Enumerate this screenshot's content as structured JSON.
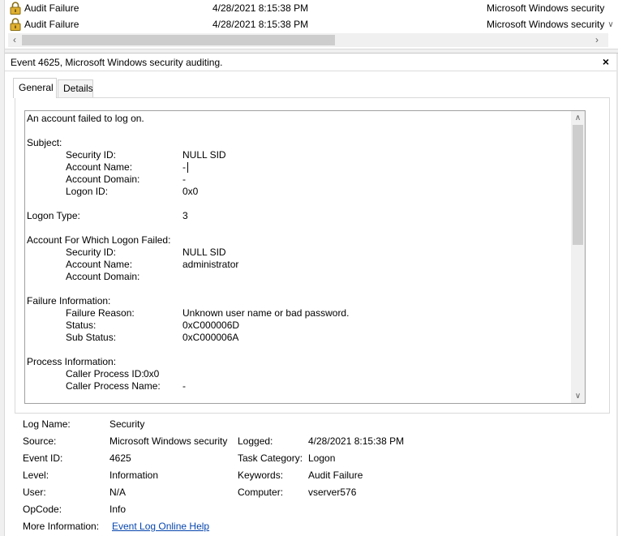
{
  "event_list": {
    "rows": [
      {
        "level": "Audit Failure",
        "date": "4/28/2021 8:15:38 PM",
        "source": "Microsoft Windows security"
      },
      {
        "level": "Audit Failure",
        "date": "4/28/2021 8:15:38 PM",
        "source": "Microsoft Windows security"
      }
    ],
    "hscroll_fraction": 0.55
  },
  "detail": {
    "title": "Event 4625, Microsoft Windows security auditing.",
    "close_label": "×",
    "tabs": [
      {
        "label": "General",
        "active": true
      },
      {
        "label": "Details",
        "active": false
      }
    ],
    "description": {
      "intro": "An account failed to log on.",
      "subject": {
        "heading": "Subject:",
        "fields": [
          {
            "label": "Security ID:",
            "value": "NULL SID"
          },
          {
            "label": "Account Name:",
            "value": "-"
          },
          {
            "label": "Account Domain:",
            "value": "-"
          },
          {
            "label": "Logon ID:",
            "value": "0x0"
          }
        ]
      },
      "logon_type": {
        "label": "Logon Type:",
        "value": "3"
      },
      "account_failed": {
        "heading": "Account For Which Logon Failed:",
        "fields": [
          {
            "label": "Security ID:",
            "value": "NULL SID"
          },
          {
            "label": "Account Name:",
            "value": "administrator"
          },
          {
            "label": "Account Domain:",
            "value": ""
          }
        ]
      },
      "failure_info": {
        "heading": "Failure Information:",
        "fields": [
          {
            "label": "Failure Reason:",
            "value": "Unknown user name or bad password."
          },
          {
            "label": "Status:",
            "value": "0xC000006D"
          },
          {
            "label": "Sub Status:",
            "value": "0xC000006A"
          }
        ]
      },
      "process_info": {
        "heading": "Process Information:",
        "fields": [
          {
            "label": "Caller Process ID:",
            "value": "0x0"
          },
          {
            "label": "Caller Process Name:",
            "value": "-"
          }
        ]
      }
    },
    "properties": {
      "log_name": {
        "label": "Log Name:",
        "value": "Security"
      },
      "source": {
        "label": "Source:",
        "value": "Microsoft Windows security"
      },
      "logged": {
        "label": "Logged:",
        "value": "4/28/2021 8:15:38 PM"
      },
      "event_id": {
        "label": "Event ID:",
        "value": "4625"
      },
      "task_category": {
        "label": "Task Category:",
        "value": "Logon"
      },
      "level": {
        "label": "Level:",
        "value": "Information"
      },
      "keywords": {
        "label": "Keywords:",
        "value": "Audit Failure"
      },
      "user": {
        "label": "User:",
        "value": "N/A"
      },
      "computer": {
        "label": "Computer:",
        "value": "vserver576"
      },
      "opcode": {
        "label": "OpCode:",
        "value": "Info"
      },
      "more_info": {
        "label": "More Information:",
        "link": "Event Log Online Help"
      }
    }
  },
  "colors": {
    "link": "#0645ad",
    "lock_gold": "#d9a520"
  }
}
